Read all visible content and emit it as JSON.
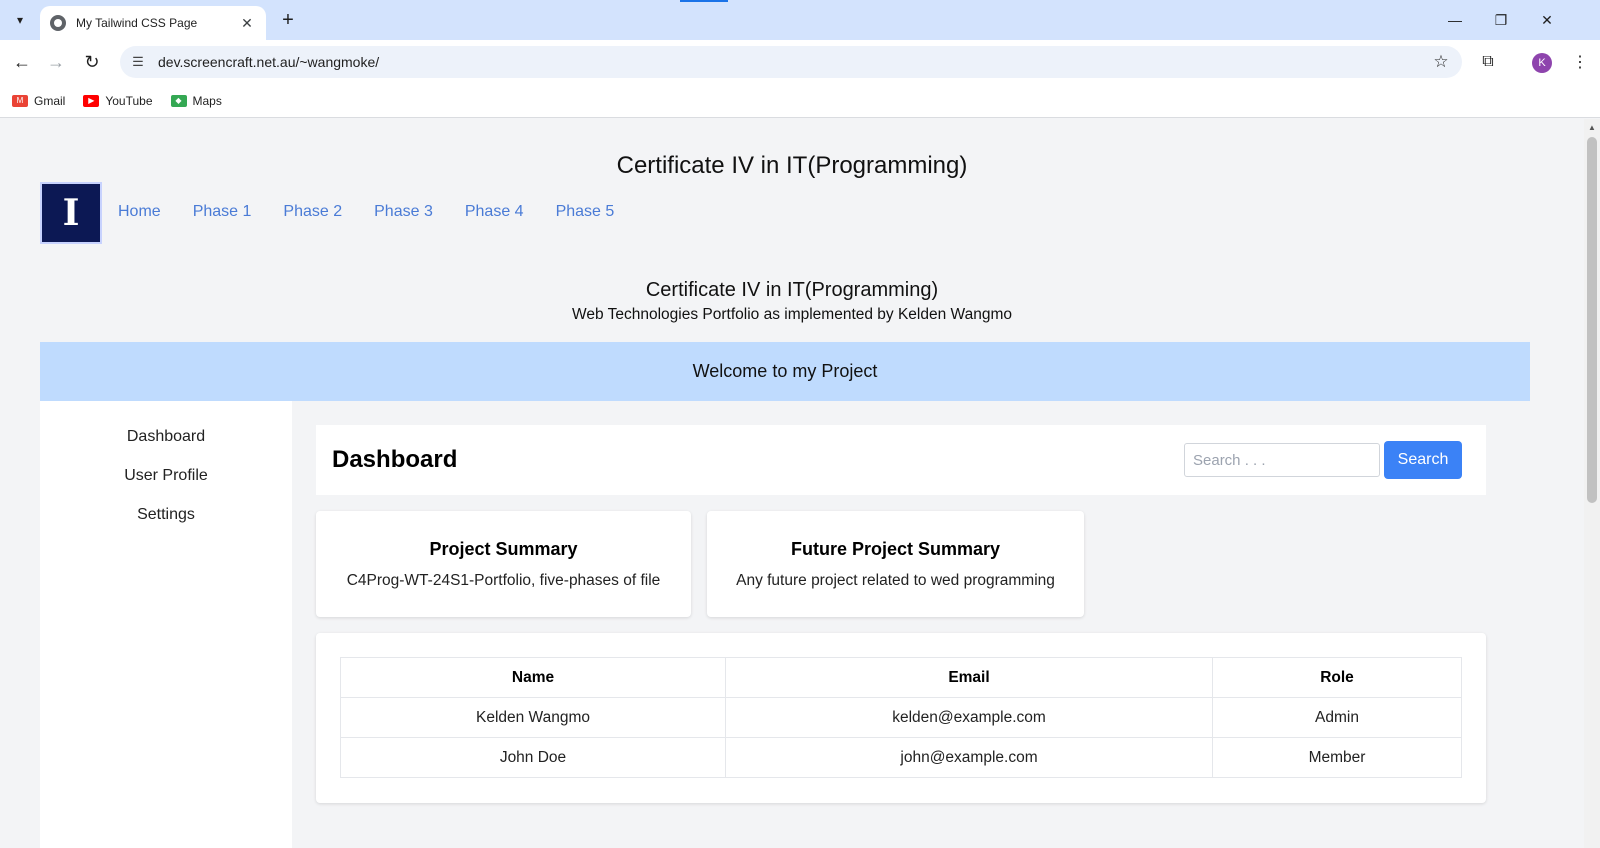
{
  "browser": {
    "tab_title": "My Tailwind CSS Page",
    "url": "dev.screencraft.net.au/~wangmoke/",
    "profile_initial": "K",
    "bookmarks": [
      {
        "label": "Gmail",
        "icon": "gmail-icon"
      },
      {
        "label": "YouTube",
        "icon": "youtube-icon"
      },
      {
        "label": "Maps",
        "icon": "maps-icon"
      }
    ]
  },
  "site": {
    "title": "Certificate IV in IT(Programming)",
    "logo_letter": "I",
    "nav": [
      "Home",
      "Phase 1",
      "Phase 2",
      "Phase 3",
      "Phase 4",
      "Phase 5"
    ]
  },
  "hero": {
    "title": "Certificate IV in IT(Programming)",
    "subtitle": "Web Technologies Portfolio as implemented by Kelden Wangmo"
  },
  "welcome": "Welcome to my Project",
  "sidebar": {
    "items": [
      "Dashboard",
      "User Profile",
      "Settings"
    ]
  },
  "dashboard": {
    "title": "Dashboard",
    "search_placeholder": "Search . . .",
    "search_button": "Search"
  },
  "cards": [
    {
      "title": "Project Summary",
      "text": "C4Prog-WT-24S1-Portfolio, five-phases of file"
    },
    {
      "title": "Future Project Summary",
      "text": "Any future project related to wed programming"
    }
  ],
  "table": {
    "headers": [
      "Name",
      "Email",
      "Role"
    ],
    "rows": [
      [
        "Kelden Wangmo",
        "kelden@example.com",
        "Admin"
      ],
      [
        "John Doe",
        "john@example.com",
        "Member"
      ]
    ]
  },
  "colors": {
    "accent": "#3b82f6",
    "nav_link": "#4a7bd6",
    "welcome_bg": "#bfdbfe",
    "logo_bg": "#0c1854"
  }
}
